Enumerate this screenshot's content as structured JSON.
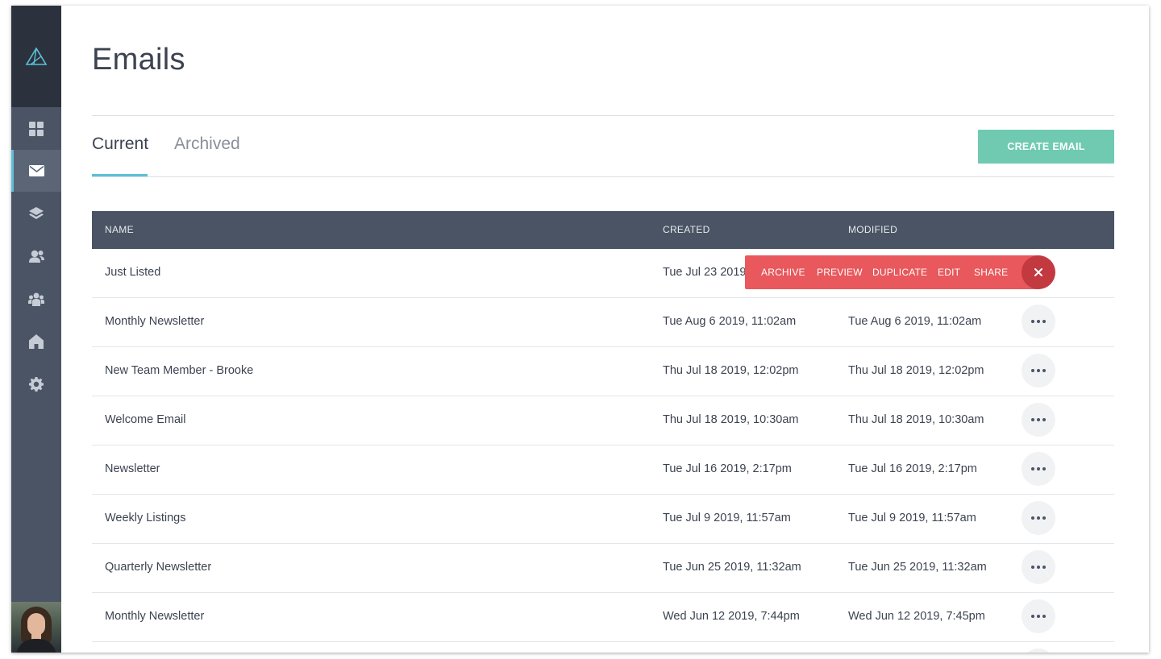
{
  "page": {
    "title": "Emails"
  },
  "tabs": [
    {
      "label": "Current",
      "active": true
    },
    {
      "label": "Archived",
      "active": false
    }
  ],
  "create_button": {
    "label": "CREATE EMAIL"
  },
  "table": {
    "columns": {
      "name": "NAME",
      "created": "CREATED",
      "modified": "MODIFIED"
    },
    "rows": [
      {
        "name": "Just Listed",
        "created": "Tue Jul 23 2019",
        "modified": ""
      },
      {
        "name": "Monthly Newsletter",
        "created": "Tue Aug 6 2019, 11:02am",
        "modified": "Tue Aug 6 2019, 11:02am"
      },
      {
        "name": "New Team Member - Brooke",
        "created": "Thu Jul 18 2019, 12:02pm",
        "modified": "Thu Jul 18 2019, 12:02pm"
      },
      {
        "name": "Welcome Email",
        "created": "Thu Jul 18 2019, 10:30am",
        "modified": "Thu Jul 18 2019, 10:30am"
      },
      {
        "name": "Newsletter",
        "created": "Tue Jul 16 2019, 2:17pm",
        "modified": "Tue Jul 16 2019, 2:17pm"
      },
      {
        "name": "Weekly Listings",
        "created": "Tue Jul 9 2019, 11:57am",
        "modified": "Tue Jul 9 2019, 11:57am"
      },
      {
        "name": "Quarterly Newsletter",
        "created": "Tue Jun 25 2019, 11:32am",
        "modified": "Tue Jun 25 2019, 11:32am"
      },
      {
        "name": "Monthly Newsletter",
        "created": "Wed Jun 12 2019, 7:44pm",
        "modified": "Wed Jun 12 2019, 7:45pm"
      }
    ]
  },
  "row_actions": {
    "archive": "ARCHIVE",
    "preview": "PREVIEW",
    "duplicate": "DUPLICATE",
    "edit": "EDIT",
    "share": "SHARE",
    "close_icon": "close-icon"
  },
  "sidebar": {
    "logo_icon": "triangle-logo-icon",
    "items": [
      {
        "icon": "dashboard-grid-icon",
        "active": false
      },
      {
        "icon": "envelope-icon",
        "active": true
      },
      {
        "icon": "layers-icon",
        "active": false
      },
      {
        "icon": "contacts-icon",
        "active": false
      },
      {
        "icon": "team-icon",
        "active": false
      },
      {
        "icon": "home-icon",
        "active": false
      },
      {
        "icon": "gear-icon",
        "active": false
      }
    ]
  },
  "colors": {
    "sidebar": "#4a5464",
    "sidebar_dark": "#2c323d",
    "accent": "#5bc0d6",
    "create_button": "#6fcab1",
    "action_bar": "#e8585c",
    "close_button": "#c2393f",
    "table_header": "#4a5464"
  }
}
